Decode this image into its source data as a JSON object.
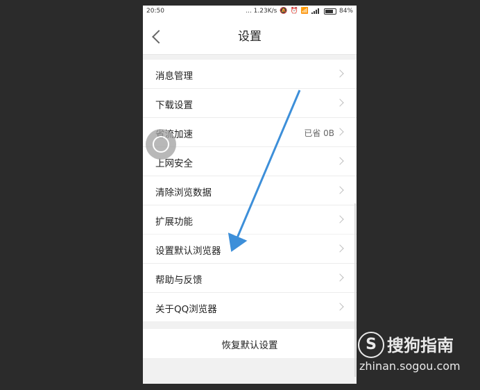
{
  "status_bar": {
    "time": "20:50",
    "network_speed": "... 1.23K/s",
    "battery": "84%",
    "icons": [
      "mute-icon",
      "alarm-icon",
      "wifi-icon",
      "signal-icon",
      "battery-icon"
    ]
  },
  "header": {
    "title": "设置",
    "back_icon": "chevron-left-icon"
  },
  "settings": {
    "group1": [
      {
        "label": "消息管理",
        "value": ""
      },
      {
        "label": "下载设置",
        "value": ""
      },
      {
        "label": "省流加速",
        "value": "已省 0B"
      },
      {
        "label": "上网安全",
        "value": ""
      },
      {
        "label": "清除浏览数据",
        "value": ""
      },
      {
        "label": "扩展功能",
        "value": ""
      }
    ],
    "group2": [
      {
        "label": "设置默认浏览器",
        "value": ""
      },
      {
        "label": "帮助与反馈",
        "value": ""
      },
      {
        "label": "关于QQ浏览器",
        "value": ""
      }
    ],
    "restore_label": "恢复默认设置"
  },
  "watermark": {
    "logo_letter": "S",
    "title": "搜狗指南",
    "url": "zhinan.sogou.com"
  },
  "colors": {
    "background": "#2b2b2b",
    "arrow": "#3d8fd9",
    "page_bg": "#f1f1f1"
  }
}
